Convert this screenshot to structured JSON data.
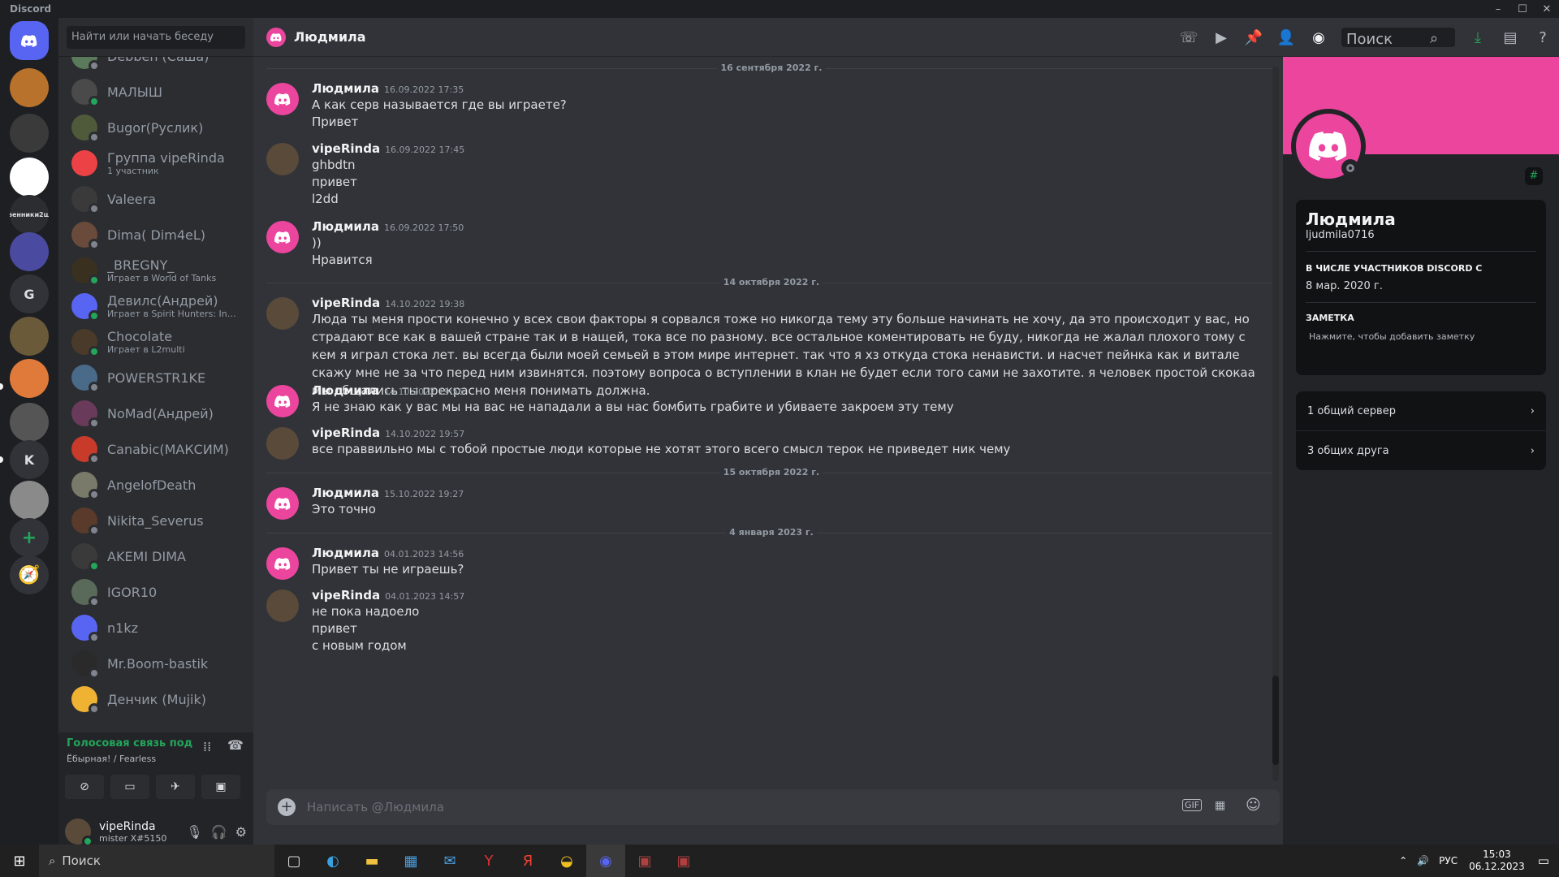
{
  "app": {
    "title": "Discord"
  },
  "window_controls": {
    "minimize": "–",
    "maximize": "☐",
    "close": "✕"
  },
  "servers": [
    {
      "label": "",
      "color": "#5865f2",
      "kind": "home"
    },
    {
      "label": "",
      "color": "#b8722c"
    },
    {
      "label": "",
      "color": "#3a3a3a"
    },
    {
      "label": "",
      "color": "#ffffff"
    },
    {
      "label": "венники2ш",
      "color": "#2b2d31"
    },
    {
      "label": "",
      "color": "#4a4aa0"
    },
    {
      "label": "G",
      "color": "#313338"
    },
    {
      "label": "",
      "color": "#6a5a3a"
    },
    {
      "label": "",
      "color": "#e07a3a"
    },
    {
      "label": "",
      "color": "#555555"
    },
    {
      "label": "K",
      "color": "#313338"
    },
    {
      "label": "",
      "color": "#8a8a8a"
    }
  ],
  "server_actions": {
    "add": "+",
    "explore": "🧭"
  },
  "dm_search": {
    "placeholder": "Найти или начать беседу"
  },
  "dms": [
    {
      "name": "Debben (Саша)",
      "sub": "",
      "color": "#5b7a5b",
      "status": "#80848e"
    },
    {
      "name": "МАЛЫШ",
      "sub": "",
      "color": "#4a4a4a",
      "status": "#23a55a"
    },
    {
      "name": "Bugor(Руслик)",
      "sub": "",
      "color": "#4e5a3a",
      "status": "#80848e"
    },
    {
      "name": "Группа vipeRinda",
      "sub": "1 участник",
      "color": "#ed4245",
      "status": ""
    },
    {
      "name": "Valeera",
      "sub": "",
      "color": "#3a3a3a",
      "status": "#80848e"
    },
    {
      "name": "Dima( Dim4eL)",
      "sub": "",
      "color": "#6a4a3a",
      "status": "#80848e"
    },
    {
      "name": "_BREGNY_",
      "sub": "Играет в World of Tanks",
      "color": "#3a3020",
      "status": "#23a55a"
    },
    {
      "name": "Девилс(Андрей)",
      "sub": "Играет в Spirit Hunters: Infini…",
      "color": "#5865f2",
      "status": "#23a55a"
    },
    {
      "name": "Chocolate",
      "sub": "Играет в L2multi",
      "color": "#4a3a2a",
      "status": "#23a55a"
    },
    {
      "name": "POWERSTR1KE",
      "sub": "",
      "color": "#4a6a8a",
      "status": "#80848e"
    },
    {
      "name": "NoMad(Андрей)",
      "sub": "",
      "color": "#6a3a5a",
      "status": "#80848e"
    },
    {
      "name": "Canabic(МАКСИМ)",
      "sub": "",
      "color": "#c83a2a",
      "status": "#80848e"
    },
    {
      "name": "AngelofDeath",
      "sub": "",
      "color": "#7a7a6a",
      "status": "#80848e"
    },
    {
      "name": "Nikita_Severus",
      "sub": "",
      "color": "#5a3a2a",
      "status": "#80848e"
    },
    {
      "name": "AKEMI DIMA",
      "sub": "",
      "color": "#3a3a3a",
      "status": "#23a55a"
    },
    {
      "name": "IGOR10",
      "sub": "",
      "color": "#5a6a5a",
      "status": "#80848e"
    },
    {
      "name": "n1kz",
      "sub": "",
      "color": "#5865f2",
      "status": "#80848e"
    },
    {
      "name": "Mr.Boom-bastik",
      "sub": "",
      "color": "#2a2a2a",
      "status": "#80848e"
    },
    {
      "name": "Денчик (Mujik)",
      "sub": "",
      "color": "#f0b232",
      "status": "#80848e"
    }
  ],
  "voice": {
    "title": "Голосовая связь под",
    "channel": "Ёбырная! / Fearless"
  },
  "user": {
    "name": "vipeRinda",
    "tag": "mister X#5150"
  },
  "chat": {
    "title": "Людмила",
    "search_placeholder": "Поиск",
    "composer_placeholder": "Написать @Людмила",
    "dividers": [
      "16 сентября 2022 г.",
      "14 октября 2022 г.",
      "15 октября 2022 г.",
      "4 января 2023 г."
    ],
    "messages": [
      {
        "author": "Людмила",
        "time": "16.09.2022 17:35",
        "avatar": "discord",
        "lines": [
          "А как серв называется где вы играете?",
          "Привет"
        ]
      },
      {
        "author": "vipeRinda",
        "time": "16.09.2022 17:45",
        "avatar": "photo",
        "lines": [
          "ghbdtn",
          "привет",
          "l2dd"
        ]
      },
      {
        "author": "Людмила",
        "time": "16.09.2022 17:50",
        "avatar": "discord",
        "lines": [
          "))",
          "Нравится"
        ]
      },
      {
        "author": "vipeRinda",
        "time": "14.10.2022 19:38",
        "avatar": "photo",
        "lines": [
          "Люда ты меня прости конечно у всех свои факторы я сорвался тоже но никогда тему эту больше начинать не хочу, да это происходит у вас,  но страдают все как в вашей стране так и в нащей, тока все по разному.  все остальное коментировать не буду, никогда не жалал плохого тому с кем я играл стока лет. вы всегда были моей семьей в этом мире интернет. так что я хз откуда стока ненависти. и насчет пейнка как и витале скажу мне не за что перед ним извинятся. поэтому вопроса о вступлении в клан не будет если того сами не захотите. я человек простой скокаа мы общались ты прекрасно меня понимать должна."
        ]
      },
      {
        "author": "Людмила",
        "time": "14.10.2022 19:56",
        "avatar": "discord",
        "lines": [
          "Я не знаю как у вас мы на вас не нападали а вы нас бомбить грабите и убиваете закроем эту тему"
        ]
      },
      {
        "author": "vipeRinda",
        "time": "14.10.2022 19:57",
        "avatar": "photo",
        "lines": [
          "все праввильно мы с тобой простые люди  которые не хотят этого всего смысл терок не приведет ник чему"
        ]
      },
      {
        "author": "Людмила",
        "time": "15.10.2022 19:27",
        "avatar": "discord",
        "lines": [
          "Это точно"
        ]
      },
      {
        "author": "Людмила",
        "time": "04.01.2023 14:56",
        "avatar": "discord",
        "lines": [
          "Привет ты не играешь?"
        ]
      },
      {
        "author": "vipeRinda",
        "time": "04.01.2023 14:57",
        "avatar": "photo",
        "lines": [
          "не пока надоело",
          "привет",
          "с новым годом"
        ]
      }
    ]
  },
  "profile": {
    "name": "Людмила",
    "username": "ljudmila0716",
    "member_since_label": "В ЧИСЛЕ УЧАСТНИКОВ DISCORD С",
    "member_since": "8 мар. 2020 г.",
    "note_label": "ЗАМЕТКА",
    "note_placeholder": "Нажмите, чтобы добавить заметку",
    "mutual_servers": "1 общий сервер",
    "mutual_friends": "3 общих друга",
    "banner_color": "#eb459e"
  },
  "taskbar": {
    "search": "Поиск",
    "lang": "РУС",
    "time": "15:03",
    "date": "06.12.2023"
  }
}
